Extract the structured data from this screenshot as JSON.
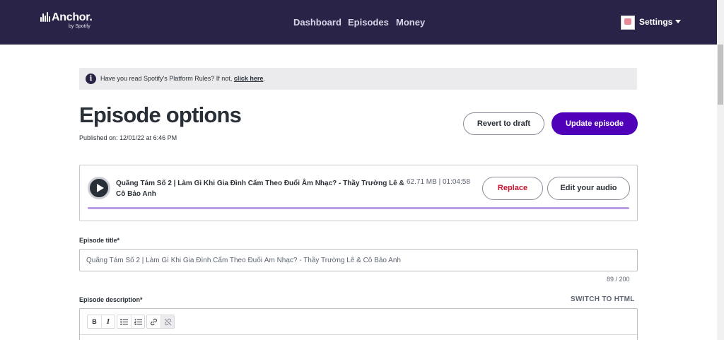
{
  "brand": {
    "name": "Anchor.",
    "sub": "by Spotify"
  },
  "nav": {
    "dashboard": "Dashboard",
    "episodes": "Episodes",
    "money": "Money",
    "settings": "Settings"
  },
  "notice": {
    "text": "Have you read Spotify's Platform Rules? If not,",
    "link": "click here",
    "end": "."
  },
  "page": {
    "title": "Episode options",
    "published": "Published on: 12/01/22 at 6:46 PM"
  },
  "buttons": {
    "revert": "Revert to draft",
    "update": "Update episode",
    "replace": "Replace",
    "edit_audio": "Edit your audio"
  },
  "audio": {
    "title": "Quãng Tám Số 2 | Làm Gì Khi Gia Đình Cấm Theo Đuổi Âm Nhạc? - Thầy Trường Lê & Cô Bảo Anh",
    "meta": "62.71 MB | 01:04:58",
    "progress": 0
  },
  "form": {
    "title_label": "Episode title*",
    "title_value": "Quãng Tám Số 2 | Làm Gì Khi Gia Đình Cấm Theo Đuổi Âm Nhạc? - Thầy Trường Lê & Cô Bảo Anh",
    "counter": "89  /  200",
    "description_label": "Episode description*",
    "switch_html": "SWITCH TO HTML"
  },
  "toolbar": {
    "bold": "B",
    "italic": "I"
  },
  "colors": {
    "nav_bg": "#292447",
    "primary": "#5000b9",
    "danger": "#c8102e"
  }
}
